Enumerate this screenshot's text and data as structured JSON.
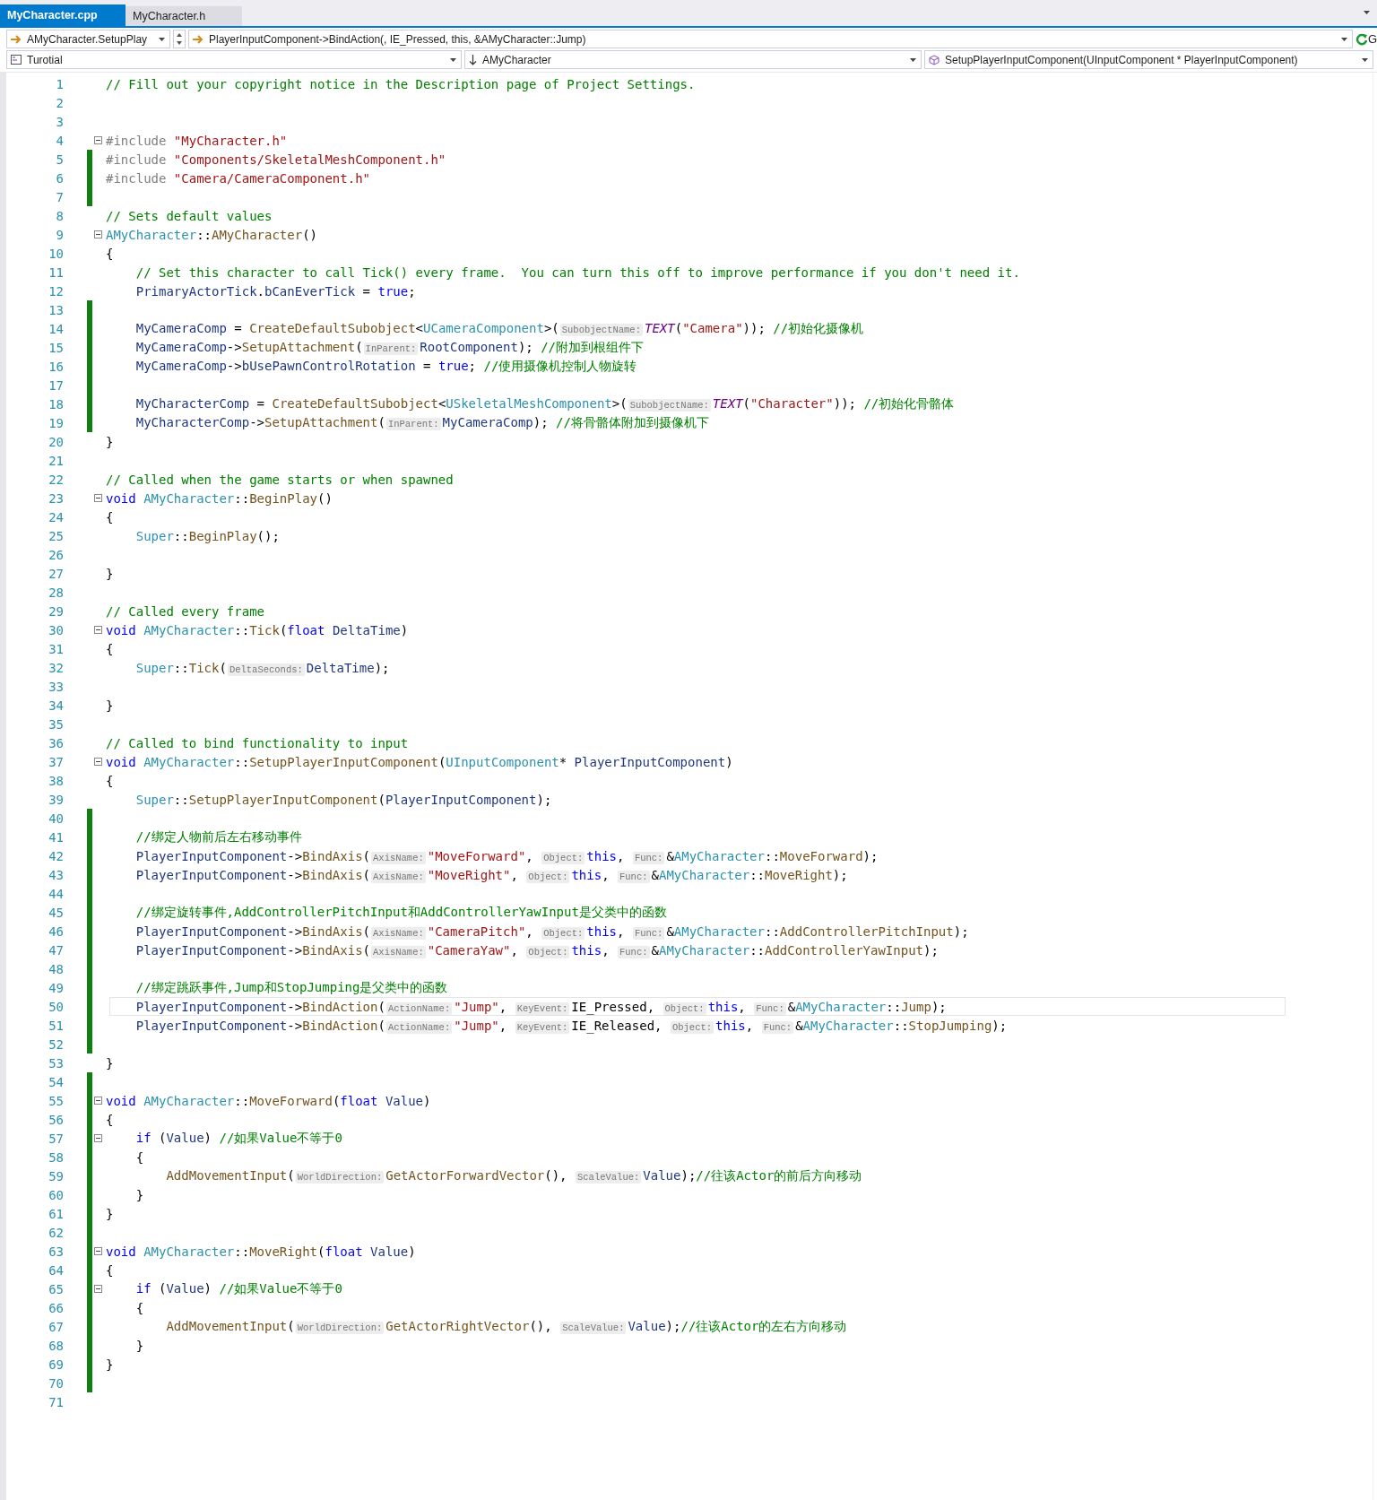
{
  "tabs": [
    {
      "label": "MyCharacter.cpp",
      "selected": true
    },
    {
      "label": "MyCharacter.h",
      "selected": false
    }
  ],
  "navigation": {
    "scope": "AMyCharacter.SetupPlay",
    "statement": "PlayerInputComponent->BindAction(, IE_Pressed, this, &AMyCharacter::Jump)",
    "button_text": "G"
  },
  "context": {
    "project": "Turotial",
    "class": "AMyCharacter",
    "member": "SetupPlayerInputComponent(UInputComponent * PlayerInputComponent)"
  },
  "lines": [
    {
      "number": "1",
      "changed": false,
      "foldable": false,
      "current": false,
      "tokens": [
        {
          "kind": "comment",
          "text": "// Fill out your copyright notice in the Description page of Project Settings."
        }
      ]
    },
    {
      "number": "2",
      "changed": false,
      "foldable": false,
      "current": false
    },
    {
      "number": "3",
      "changed": false,
      "foldable": false,
      "current": false
    },
    {
      "number": "4",
      "changed": false,
      "foldable": true,
      "current": false,
      "tokens": [
        {
          "kind": "preproc",
          "text": "#include "
        },
        {
          "kind": "string",
          "text": "\"MyCharacter.h\""
        }
      ]
    },
    {
      "number": "5",
      "changed": true,
      "foldable": false,
      "current": false,
      "tokens": [
        {
          "kind": "preproc",
          "text": "#include "
        },
        {
          "kind": "string",
          "text": "\"Components/SkeletalMeshComponent.h\""
        }
      ]
    },
    {
      "number": "6",
      "changed": true,
      "foldable": false,
      "current": false,
      "tokens": [
        {
          "kind": "preproc",
          "text": "#include "
        },
        {
          "kind": "string",
          "text": "\"Camera/CameraComponent.h\""
        }
      ]
    },
    {
      "number": "7",
      "changed": true,
      "foldable": false,
      "current": false
    },
    {
      "number": "8",
      "changed": false,
      "foldable": false,
      "current": false,
      "tokens": [
        {
          "kind": "comment",
          "text": "// Sets default values"
        }
      ]
    },
    {
      "number": "9",
      "changed": false,
      "foldable": true,
      "current": false,
      "tokens": [
        {
          "kind": "type",
          "text": "AMyCharacter"
        },
        {
          "kind": "plain",
          "text": "::"
        },
        {
          "kind": "function",
          "text": "AMyCharacter"
        },
        {
          "kind": "plain",
          "text": "()"
        }
      ]
    },
    {
      "number": "10",
      "changed": false,
      "foldable": false,
      "current": false,
      "tokens": [
        {
          "kind": "plain",
          "text": "{"
        }
      ]
    },
    {
      "number": "11",
      "changed": false,
      "foldable": false,
      "current": false,
      "tokens": [
        {
          "kind": "comment",
          "text": "    // Set this character to call Tick() every frame.  You can turn this off to improve performance if you don't need it."
        }
      ]
    },
    {
      "number": "12",
      "changed": false,
      "foldable": false,
      "current": false,
      "tokens": [
        {
          "kind": "member",
          "text": "    PrimaryActorTick"
        },
        {
          "kind": "plain",
          "text": "."
        },
        {
          "kind": "member",
          "text": "bCanEverTick"
        },
        {
          "kind": "plain",
          "text": " = "
        },
        {
          "kind": "keyword",
          "text": "true"
        },
        {
          "kind": "plain",
          "text": ";"
        }
      ]
    },
    {
      "number": "13",
      "changed": true,
      "foldable": false,
      "current": false
    },
    {
      "number": "14",
      "changed": true,
      "foldable": false,
      "current": false,
      "tokens": [
        {
          "kind": "member",
          "text": "    MyCameraComp"
        },
        {
          "kind": "plain",
          "text": " = "
        },
        {
          "kind": "function",
          "text": "CreateDefaultSubobject"
        },
        {
          "kind": "plain",
          "text": "<"
        },
        {
          "kind": "type",
          "text": "UCameraComponent"
        },
        {
          "kind": "plain",
          "text": ">("
        },
        {
          "kind": "hint",
          "text": "SubobjectName:"
        },
        {
          "kind": "macro",
          "text": "TEXT"
        },
        {
          "kind": "plain",
          "text": "("
        },
        {
          "kind": "string",
          "text": "\"Camera\""
        },
        {
          "kind": "plain",
          "text": ")); "
        },
        {
          "kind": "comment",
          "text": "//初始化摄像机"
        }
      ]
    },
    {
      "number": "15",
      "changed": true,
      "foldable": false,
      "current": false,
      "tokens": [
        {
          "kind": "member",
          "text": "    MyCameraComp"
        },
        {
          "kind": "plain",
          "text": "->"
        },
        {
          "kind": "function",
          "text": "SetupAttachment"
        },
        {
          "kind": "plain",
          "text": "("
        },
        {
          "kind": "hint",
          "text": "InParent:"
        },
        {
          "kind": "member",
          "text": "RootComponent"
        },
        {
          "kind": "plain",
          "text": "); "
        },
        {
          "kind": "comment",
          "text": "//附加到根组件下"
        }
      ]
    },
    {
      "number": "16",
      "changed": true,
      "foldable": false,
      "current": false,
      "tokens": [
        {
          "kind": "member",
          "text": "    MyCameraComp"
        },
        {
          "kind": "plain",
          "text": "->"
        },
        {
          "kind": "member",
          "text": "bUsePawnControlRotation"
        },
        {
          "kind": "plain",
          "text": " = "
        },
        {
          "kind": "keyword",
          "text": "true"
        },
        {
          "kind": "plain",
          "text": "; "
        },
        {
          "kind": "comment",
          "text": "//使用摄像机控制人物旋转"
        }
      ]
    },
    {
      "number": "17",
      "changed": true,
      "foldable": false,
      "current": false
    },
    {
      "number": "18",
      "changed": true,
      "foldable": false,
      "current": false,
      "tokens": [
        {
          "kind": "member",
          "text": "    MyCharacterComp"
        },
        {
          "kind": "plain",
          "text": " = "
        },
        {
          "kind": "function",
          "text": "CreateDefaultSubobject"
        },
        {
          "kind": "plain",
          "text": "<"
        },
        {
          "kind": "type",
          "text": "USkeletalMeshComponent"
        },
        {
          "kind": "plain",
          "text": ">("
        },
        {
          "kind": "hint",
          "text": "SubobjectName:"
        },
        {
          "kind": "macro",
          "text": "TEXT"
        },
        {
          "kind": "plain",
          "text": "("
        },
        {
          "kind": "string",
          "text": "\"Character\""
        },
        {
          "kind": "plain",
          "text": ")); "
        },
        {
          "kind": "comment",
          "text": "//初始化骨骼体"
        }
      ]
    },
    {
      "number": "19",
      "changed": true,
      "foldable": false,
      "current": false,
      "tokens": [
        {
          "kind": "member",
          "text": "    MyCharacterComp"
        },
        {
          "kind": "plain",
          "text": "->"
        },
        {
          "kind": "function",
          "text": "SetupAttachment"
        },
        {
          "kind": "plain",
          "text": "("
        },
        {
          "kind": "hint",
          "text": "InParent:"
        },
        {
          "kind": "member",
          "text": "MyCameraComp"
        },
        {
          "kind": "plain",
          "text": "); "
        },
        {
          "kind": "comment",
          "text": "//将骨骼体附加到摄像机下"
        }
      ]
    },
    {
      "number": "20",
      "changed": false,
      "foldable": false,
      "current": false,
      "tokens": [
        {
          "kind": "plain",
          "text": "}"
        }
      ]
    },
    {
      "number": "21",
      "changed": false,
      "foldable": false,
      "current": false
    },
    {
      "number": "22",
      "changed": false,
      "foldable": false,
      "current": false,
      "tokens": [
        {
          "kind": "comment",
          "text": "// Called when the game starts or when spawned"
        }
      ]
    },
    {
      "number": "23",
      "changed": false,
      "foldable": true,
      "current": false,
      "tokens": [
        {
          "kind": "keyword",
          "text": "void"
        },
        {
          "kind": "type",
          "text": " AMyCharacter"
        },
        {
          "kind": "plain",
          "text": "::"
        },
        {
          "kind": "function",
          "text": "BeginPlay"
        },
        {
          "kind": "plain",
          "text": "()"
        }
      ]
    },
    {
      "number": "24",
      "changed": false,
      "foldable": false,
      "current": false,
      "tokens": [
        {
          "kind": "plain",
          "text": "{"
        }
      ]
    },
    {
      "number": "25",
      "changed": false,
      "foldable": false,
      "current": false,
      "tokens": [
        {
          "kind": "type",
          "text": "    Super"
        },
        {
          "kind": "plain",
          "text": "::"
        },
        {
          "kind": "function",
          "text": "BeginPlay"
        },
        {
          "kind": "plain",
          "text": "();"
        }
      ]
    },
    {
      "number": "26",
      "changed": false,
      "foldable": false,
      "current": false
    },
    {
      "number": "27",
      "changed": false,
      "foldable": false,
      "current": false,
      "tokens": [
        {
          "kind": "plain",
          "text": "}"
        }
      ]
    },
    {
      "number": "28",
      "changed": false,
      "foldable": false,
      "current": false
    },
    {
      "number": "29",
      "changed": false,
      "foldable": false,
      "current": false,
      "tokens": [
        {
          "kind": "comment",
          "text": "// Called every frame"
        }
      ]
    },
    {
      "number": "30",
      "changed": false,
      "foldable": true,
      "current": false,
      "tokens": [
        {
          "kind": "keyword",
          "text": "void"
        },
        {
          "kind": "type",
          "text": " AMyCharacter"
        },
        {
          "kind": "plain",
          "text": "::"
        },
        {
          "kind": "function",
          "text": "Tick"
        },
        {
          "kind": "plain",
          "text": "("
        },
        {
          "kind": "keyword",
          "text": "float"
        },
        {
          "kind": "param",
          "text": " DeltaTime"
        },
        {
          "kind": "plain",
          "text": ")"
        }
      ]
    },
    {
      "number": "31",
      "changed": false,
      "foldable": false,
      "current": false,
      "tokens": [
        {
          "kind": "plain",
          "text": "{"
        }
      ]
    },
    {
      "number": "32",
      "changed": false,
      "foldable": false,
      "current": false,
      "tokens": [
        {
          "kind": "type",
          "text": "    Super"
        },
        {
          "kind": "plain",
          "text": "::"
        },
        {
          "kind": "function",
          "text": "Tick"
        },
        {
          "kind": "plain",
          "text": "("
        },
        {
          "kind": "hint",
          "text": "DeltaSeconds:"
        },
        {
          "kind": "param",
          "text": "DeltaTime"
        },
        {
          "kind": "plain",
          "text": ");"
        }
      ]
    },
    {
      "number": "33",
      "changed": false,
      "foldable": false,
      "current": false
    },
    {
      "number": "34",
      "changed": false,
      "foldable": false,
      "current": false,
      "tokens": [
        {
          "kind": "plain",
          "text": "}"
        }
      ]
    },
    {
      "number": "35",
      "changed": false,
      "foldable": false,
      "current": false
    },
    {
      "number": "36",
      "changed": false,
      "foldable": false,
      "current": false,
      "tokens": [
        {
          "kind": "comment",
          "text": "// Called to bind functionality to input"
        }
      ]
    },
    {
      "number": "37",
      "changed": false,
      "foldable": true,
      "current": false,
      "tokens": [
        {
          "kind": "keyword",
          "text": "void"
        },
        {
          "kind": "type",
          "text": " AMyCharacter"
        },
        {
          "kind": "plain",
          "text": "::"
        },
        {
          "kind": "function",
          "text": "SetupPlayerInputComponent"
        },
        {
          "kind": "plain",
          "text": "("
        },
        {
          "kind": "type",
          "text": "UInputComponent"
        },
        {
          "kind": "plain",
          "text": "*"
        },
        {
          "kind": "param",
          "text": " PlayerInputComponent"
        },
        {
          "kind": "plain",
          "text": ")"
        }
      ]
    },
    {
      "number": "38",
      "changed": false,
      "foldable": false,
      "current": false,
      "tokens": [
        {
          "kind": "plain",
          "text": "{"
        }
      ]
    },
    {
      "number": "39",
      "changed": false,
      "foldable": false,
      "current": false,
      "tokens": [
        {
          "kind": "type",
          "text": "    Super"
        },
        {
          "kind": "plain",
          "text": "::"
        },
        {
          "kind": "function",
          "text": "SetupPlayerInputComponent"
        },
        {
          "kind": "plain",
          "text": "("
        },
        {
          "kind": "param",
          "text": "PlayerInputComponent"
        },
        {
          "kind": "plain",
          "text": ");"
        }
      ]
    },
    {
      "number": "40",
      "changed": true,
      "foldable": false,
      "current": false
    },
    {
      "number": "41",
      "changed": true,
      "foldable": false,
      "current": false,
      "tokens": [
        {
          "kind": "comment",
          "text": "    //绑定人物前后左右移动事件"
        }
      ]
    },
    {
      "number": "42",
      "changed": true,
      "foldable": false,
      "current": false,
      "tokens": [
        {
          "kind": "param",
          "text": "    PlayerInputComponent"
        },
        {
          "kind": "plain",
          "text": "->"
        },
        {
          "kind": "function",
          "text": "BindAxis"
        },
        {
          "kind": "plain",
          "text": "("
        },
        {
          "kind": "hint",
          "text": "AxisName:"
        },
        {
          "kind": "string",
          "text": "\"MoveForward\""
        },
        {
          "kind": "plain",
          "text": ", "
        },
        {
          "kind": "hint",
          "text": "Object:"
        },
        {
          "kind": "keyword",
          "text": "this"
        },
        {
          "kind": "plain",
          "text": ", "
        },
        {
          "kind": "hint",
          "text": "Func:"
        },
        {
          "kind": "plain",
          "text": "&"
        },
        {
          "kind": "type",
          "text": "AMyCharacter"
        },
        {
          "kind": "plain",
          "text": "::"
        },
        {
          "kind": "function",
          "text": "MoveForward"
        },
        {
          "kind": "plain",
          "text": ");"
        }
      ]
    },
    {
      "number": "43",
      "changed": true,
      "foldable": false,
      "current": false,
      "tokens": [
        {
          "kind": "param",
          "text": "    PlayerInputComponent"
        },
        {
          "kind": "plain",
          "text": "->"
        },
        {
          "kind": "function",
          "text": "BindAxis"
        },
        {
          "kind": "plain",
          "text": "("
        },
        {
          "kind": "hint",
          "text": "AxisName:"
        },
        {
          "kind": "string",
          "text": "\"MoveRight\""
        },
        {
          "kind": "plain",
          "text": ", "
        },
        {
          "kind": "hint",
          "text": "Object:"
        },
        {
          "kind": "keyword",
          "text": "this"
        },
        {
          "kind": "plain",
          "text": ", "
        },
        {
          "kind": "hint",
          "text": "Func:"
        },
        {
          "kind": "plain",
          "text": "&"
        },
        {
          "kind": "type",
          "text": "AMyCharacter"
        },
        {
          "kind": "plain",
          "text": "::"
        },
        {
          "kind": "function",
          "text": "MoveRight"
        },
        {
          "kind": "plain",
          "text": ");"
        }
      ]
    },
    {
      "number": "44",
      "changed": true,
      "foldable": false,
      "current": false
    },
    {
      "number": "45",
      "changed": true,
      "foldable": false,
      "current": false,
      "tokens": [
        {
          "kind": "comment",
          "text": "    //绑定旋转事件,AddControllerPitchInput和AddControllerYawInput是父类中的函数"
        }
      ]
    },
    {
      "number": "46",
      "changed": true,
      "foldable": false,
      "current": false,
      "tokens": [
        {
          "kind": "param",
          "text": "    PlayerInputComponent"
        },
        {
          "kind": "plain",
          "text": "->"
        },
        {
          "kind": "function",
          "text": "BindAxis"
        },
        {
          "kind": "plain",
          "text": "("
        },
        {
          "kind": "hint",
          "text": "AxisName:"
        },
        {
          "kind": "string",
          "text": "\"CameraPitch\""
        },
        {
          "kind": "plain",
          "text": ", "
        },
        {
          "kind": "hint",
          "text": "Object:"
        },
        {
          "kind": "keyword",
          "text": "this"
        },
        {
          "kind": "plain",
          "text": ", "
        },
        {
          "kind": "hint",
          "text": "Func:"
        },
        {
          "kind": "plain",
          "text": "&"
        },
        {
          "kind": "type",
          "text": "AMyCharacter"
        },
        {
          "kind": "plain",
          "text": "::"
        },
        {
          "kind": "function",
          "text": "AddControllerPitchInput"
        },
        {
          "kind": "plain",
          "text": ");"
        }
      ]
    },
    {
      "number": "47",
      "changed": true,
      "foldable": false,
      "current": false,
      "tokens": [
        {
          "kind": "param",
          "text": "    PlayerInputComponent"
        },
        {
          "kind": "plain",
          "text": "->"
        },
        {
          "kind": "function",
          "text": "BindAxis"
        },
        {
          "kind": "plain",
          "text": "("
        },
        {
          "kind": "hint",
          "text": "AxisName:"
        },
        {
          "kind": "string",
          "text": "\"CameraYaw\""
        },
        {
          "kind": "plain",
          "text": ", "
        },
        {
          "kind": "hint",
          "text": "Object:"
        },
        {
          "kind": "keyword",
          "text": "this"
        },
        {
          "kind": "plain",
          "text": ", "
        },
        {
          "kind": "hint",
          "text": "Func:"
        },
        {
          "kind": "plain",
          "text": "&"
        },
        {
          "kind": "type",
          "text": "AMyCharacter"
        },
        {
          "kind": "plain",
          "text": "::"
        },
        {
          "kind": "function",
          "text": "AddControllerYawInput"
        },
        {
          "kind": "plain",
          "text": ");"
        }
      ]
    },
    {
      "number": "48",
      "changed": true,
      "foldable": false,
      "current": false
    },
    {
      "number": "49",
      "changed": true,
      "foldable": false,
      "current": false,
      "tokens": [
        {
          "kind": "comment",
          "text": "    //绑定跳跃事件,Jump和StopJumping是父类中的函数"
        }
      ]
    },
    {
      "number": "50",
      "changed": true,
      "foldable": false,
      "current": true,
      "tokens": [
        {
          "kind": "param",
          "text": "    PlayerInputComponent"
        },
        {
          "kind": "plain",
          "text": "->"
        },
        {
          "kind": "function",
          "text": "BindAction"
        },
        {
          "kind": "plain",
          "text": "("
        },
        {
          "kind": "hint",
          "text": "ActionName:"
        },
        {
          "kind": "string",
          "text": "\"Jump\""
        },
        {
          "kind": "plain",
          "text": ", "
        },
        {
          "kind": "hint",
          "text": "KeyEvent:"
        },
        {
          "kind": "plain",
          "text": "IE_Pressed, "
        },
        {
          "kind": "hint",
          "text": "Object:"
        },
        {
          "kind": "keyword",
          "text": "this"
        },
        {
          "kind": "plain",
          "text": ", "
        },
        {
          "kind": "hint",
          "text": "Func:"
        },
        {
          "kind": "plain",
          "text": "&"
        },
        {
          "kind": "type",
          "text": "AMyCharacter"
        },
        {
          "kind": "plain",
          "text": "::"
        },
        {
          "kind": "function",
          "text": "Jump"
        },
        {
          "kind": "plain",
          "text": ");"
        }
      ]
    },
    {
      "number": "51",
      "changed": true,
      "foldable": false,
      "current": false,
      "tokens": [
        {
          "kind": "param",
          "text": "    PlayerInputComponent"
        },
        {
          "kind": "plain",
          "text": "->"
        },
        {
          "kind": "function",
          "text": "BindAction"
        },
        {
          "kind": "plain",
          "text": "("
        },
        {
          "kind": "hint",
          "text": "ActionName:"
        },
        {
          "kind": "string",
          "text": "\"Jump\""
        },
        {
          "kind": "plain",
          "text": ", "
        },
        {
          "kind": "hint",
          "text": "KeyEvent:"
        },
        {
          "kind": "plain",
          "text": "IE_Released, "
        },
        {
          "kind": "hint",
          "text": "Object:"
        },
        {
          "kind": "keyword",
          "text": "this"
        },
        {
          "kind": "plain",
          "text": ", "
        },
        {
          "kind": "hint",
          "text": "Func:"
        },
        {
          "kind": "plain",
          "text": "&"
        },
        {
          "kind": "type",
          "text": "AMyCharacter"
        },
        {
          "kind": "plain",
          "text": "::"
        },
        {
          "kind": "function",
          "text": "StopJumping"
        },
        {
          "kind": "plain",
          "text": ");"
        }
      ]
    },
    {
      "number": "52",
      "changed": true,
      "foldable": false,
      "current": false
    },
    {
      "number": "53",
      "changed": false,
      "foldable": false,
      "current": false,
      "tokens": [
        {
          "kind": "plain",
          "text": "}"
        }
      ]
    },
    {
      "number": "54",
      "changed": true,
      "foldable": false,
      "current": false
    },
    {
      "number": "55",
      "changed": true,
      "foldable": true,
      "current": false,
      "tokens": [
        {
          "kind": "keyword",
          "text": "void"
        },
        {
          "kind": "type",
          "text": " AMyCharacter"
        },
        {
          "kind": "plain",
          "text": "::"
        },
        {
          "kind": "function",
          "text": "MoveForward"
        },
        {
          "kind": "plain",
          "text": "("
        },
        {
          "kind": "keyword",
          "text": "float"
        },
        {
          "kind": "param",
          "text": " Value"
        },
        {
          "kind": "plain",
          "text": ")"
        }
      ]
    },
    {
      "number": "56",
      "changed": true,
      "foldable": false,
      "current": false,
      "tokens": [
        {
          "kind": "plain",
          "text": "{"
        }
      ]
    },
    {
      "number": "57",
      "changed": true,
      "foldable": true,
      "current": false,
      "tokens": [
        {
          "kind": "keyword",
          "text": "    if"
        },
        {
          "kind": "plain",
          "text": " ("
        },
        {
          "kind": "param",
          "text": "Value"
        },
        {
          "kind": "plain",
          "text": ") "
        },
        {
          "kind": "comment",
          "text": "//如果Value不等于0"
        }
      ]
    },
    {
      "number": "58",
      "changed": true,
      "foldable": false,
      "current": false,
      "tokens": [
        {
          "kind": "plain",
          "text": "    {"
        }
      ]
    },
    {
      "number": "59",
      "changed": true,
      "foldable": false,
      "current": false,
      "tokens": [
        {
          "kind": "function",
          "text": "        AddMovementInput"
        },
        {
          "kind": "plain",
          "text": "("
        },
        {
          "kind": "hint",
          "text": "WorldDirection:"
        },
        {
          "kind": "function",
          "text": "GetActorForwardVector"
        },
        {
          "kind": "plain",
          "text": "(), "
        },
        {
          "kind": "hint",
          "text": "ScaleValue:"
        },
        {
          "kind": "param",
          "text": "Value"
        },
        {
          "kind": "plain",
          "text": ");"
        },
        {
          "kind": "comment",
          "text": "//往该Actor的前后方向移动"
        }
      ]
    },
    {
      "number": "60",
      "changed": true,
      "foldable": false,
      "current": false,
      "tokens": [
        {
          "kind": "plain",
          "text": "    }"
        }
      ]
    },
    {
      "number": "61",
      "changed": true,
      "foldable": false,
      "current": false,
      "tokens": [
        {
          "kind": "plain",
          "text": "}"
        }
      ]
    },
    {
      "number": "62",
      "changed": true,
      "foldable": false,
      "current": false
    },
    {
      "number": "63",
      "changed": true,
      "foldable": true,
      "current": false,
      "tokens": [
        {
          "kind": "keyword",
          "text": "void"
        },
        {
          "kind": "type",
          "text": " AMyCharacter"
        },
        {
          "kind": "plain",
          "text": "::"
        },
        {
          "kind": "function",
          "text": "MoveRight"
        },
        {
          "kind": "plain",
          "text": "("
        },
        {
          "kind": "keyword",
          "text": "float"
        },
        {
          "kind": "param",
          "text": " Value"
        },
        {
          "kind": "plain",
          "text": ")"
        }
      ]
    },
    {
      "number": "64",
      "changed": true,
      "foldable": false,
      "current": false,
      "tokens": [
        {
          "kind": "plain",
          "text": "{"
        }
      ]
    },
    {
      "number": "65",
      "changed": true,
      "foldable": true,
      "current": false,
      "tokens": [
        {
          "kind": "keyword",
          "text": "    if"
        },
        {
          "kind": "plain",
          "text": " ("
        },
        {
          "kind": "param",
          "text": "Value"
        },
        {
          "kind": "plain",
          "text": ") "
        },
        {
          "kind": "comment",
          "text": "//如果Value不等于0"
        }
      ]
    },
    {
      "number": "66",
      "changed": true,
      "foldable": false,
      "current": false,
      "tokens": [
        {
          "kind": "plain",
          "text": "    {"
        }
      ]
    },
    {
      "number": "67",
      "changed": true,
      "foldable": false,
      "current": false,
      "tokens": [
        {
          "kind": "function",
          "text": "        AddMovementInput"
        },
        {
          "kind": "plain",
          "text": "("
        },
        {
          "kind": "hint",
          "text": "WorldDirection:"
        },
        {
          "kind": "function",
          "text": "GetActorRightVector"
        },
        {
          "kind": "plain",
          "text": "(), "
        },
        {
          "kind": "hint",
          "text": "ScaleValue:"
        },
        {
          "kind": "param",
          "text": "Value"
        },
        {
          "kind": "plain",
          "text": ");"
        },
        {
          "kind": "comment",
          "text": "//往该Actor的左右方向移动"
        }
      ]
    },
    {
      "number": "68",
      "changed": true,
      "foldable": false,
      "current": false,
      "tokens": [
        {
          "kind": "plain",
          "text": "    }"
        }
      ]
    },
    {
      "number": "69",
      "changed": true,
      "foldable": false,
      "current": false,
      "tokens": [
        {
          "kind": "plain",
          "text": "}"
        }
      ]
    },
    {
      "number": "70",
      "changed": true,
      "foldable": false,
      "current": false
    },
    {
      "number": "71",
      "changed": false,
      "foldable": false,
      "current": false
    }
  ]
}
